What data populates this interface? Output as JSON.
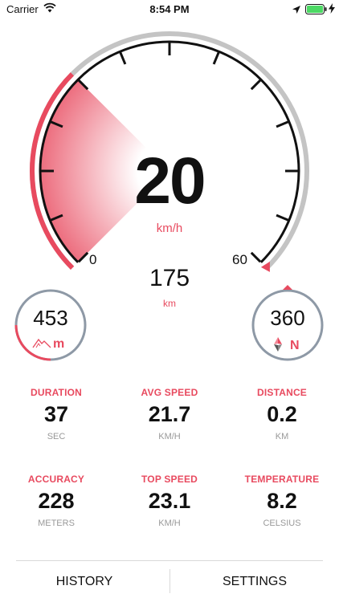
{
  "status_bar": {
    "carrier": "Carrier",
    "time": "8:54 PM",
    "wifi_icon": "wifi-icon",
    "location_icon": "location-arrow-icon",
    "battery_icon": "battery-icon",
    "battery_color": "#4cd964"
  },
  "speedometer": {
    "speed": "20",
    "speed_unit": "km/h",
    "distance": "175",
    "distance_unit": "km",
    "scale_min": "0",
    "scale_max": "60",
    "speed_fraction_of_max": 0.333
  },
  "altitude": {
    "value": "453",
    "unit": "m",
    "icon": "mountain-icon"
  },
  "heading": {
    "value": "360",
    "direction": "N",
    "icon": "compass-needle-icon"
  },
  "stats": [
    {
      "label": "DURATION",
      "value": "37",
      "unit": "SEC"
    },
    {
      "label": "AVG SPEED",
      "value": "21.7",
      "unit": "KM/H"
    },
    {
      "label": "DISTANCE",
      "value": "0.2",
      "unit": "KM"
    },
    {
      "label": "ACCURACY",
      "value": "228",
      "unit": "METERS"
    },
    {
      "label": "TOP SPEED",
      "value": "23.1",
      "unit": "KM/H"
    },
    {
      "label": "TEMPERATURE",
      "value": "8.2",
      "unit": "CELSIUS"
    }
  ],
  "bottom_bar": {
    "history": "HISTORY",
    "settings": "SETTINGS"
  },
  "colors": {
    "accent": "#e84a5f",
    "track": "#c4c4c4",
    "ring": "#8e99a6"
  }
}
